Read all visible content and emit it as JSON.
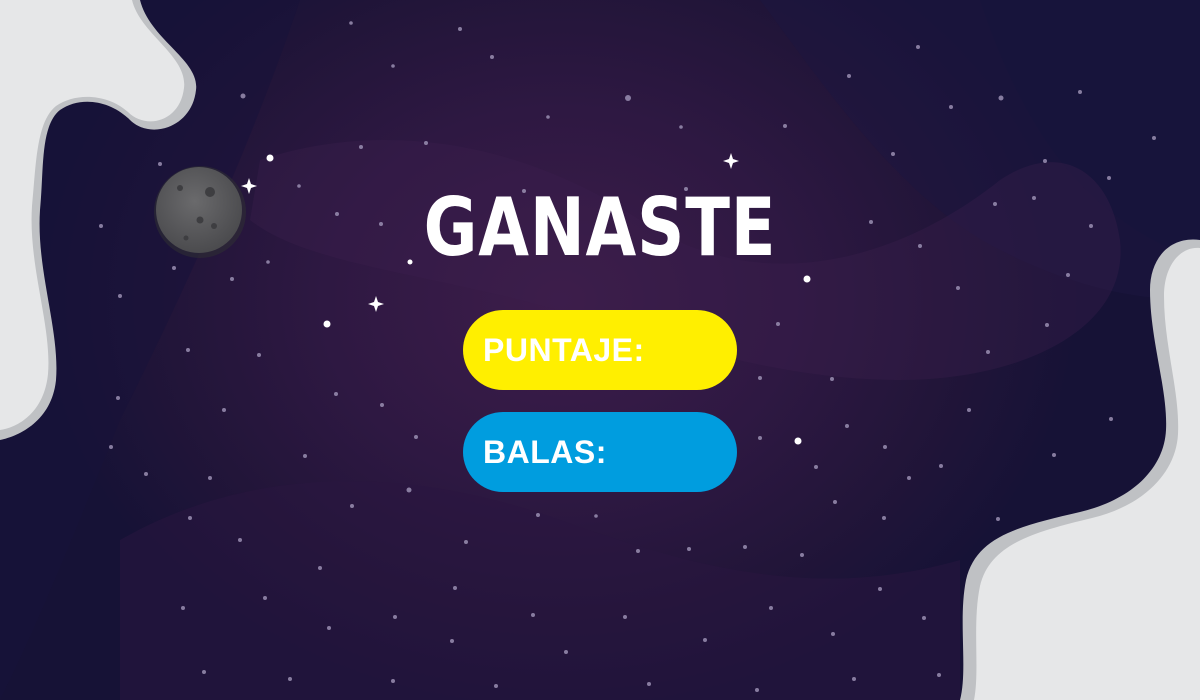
{
  "title": "GANASTE",
  "score": {
    "label": "PUNTAJE:",
    "value": ""
  },
  "ammo": {
    "label": "BALAS:",
    "value": ""
  },
  "colors": {
    "background": "#2e1842",
    "score_pill": "#ffef00",
    "ammo_pill": "#009ddf",
    "clouds": "#e6e7e8",
    "moon": "#5e5e60"
  }
}
